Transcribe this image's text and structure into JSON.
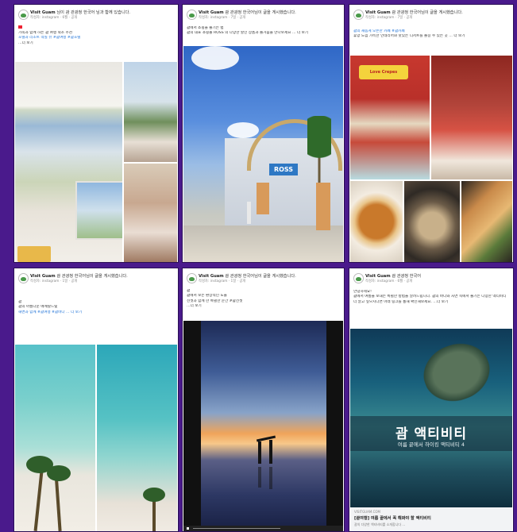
{
  "page": {
    "background": "#4a1a8c"
  },
  "posts": [
    {
      "author": "Visit Guam",
      "author_suffix": "님이 괌 관광청 한국어 님과 함께 있습니다.",
      "meta": "작성자: instagram · 6월 · 공개",
      "lines": [
        "가족과 함께 하는 괌 여행 숙소 추천",
        "호텔과 리조트 객실 뷰 #괌여행 #괌호텔",
        "…더 보기"
      ],
      "photos": [
        "hotel-lobby",
        "ocean-view-room",
        "room-interior"
      ]
    },
    {
      "author": "Visit Guam",
      "author_suffix": "괌 관광청 한국어님이 글을 게시했습니다.",
      "meta": "작성자: instagram · 7일 · 공개",
      "lines": [
        "괌에서 쇼핑을 즐기는 법",
        "괌의 대표 쇼핑몰 ROSS 의 다양한 할인 상품과 즐거움을 만나보세요 … 더 보기"
      ],
      "photos": [
        "ross-store"
      ],
      "store_sign": "ROSS"
    },
    {
      "author": "Visit Guam",
      "author_suffix": "괌 관광청 한국어님이 글을 게시했습니다.",
      "meta": "작성자: instagram · 7일 · 공개",
      "lines": [
        "괌의 새롭게 오픈한 카페 #괌카페",
        "휴양 느낌 가득한 인테리어와 맛있는 디저트를 즐길 수 있는 곳 … 더 보기"
      ],
      "photos": [
        "cafe-exterior",
        "cafe-interior",
        "food-pizza",
        "food-bowl",
        "food-crepe"
      ],
      "cafe_sign": "Love Crepes"
    },
    {
      "author": "Visit Guam",
      "author_suffix": "괌 관광청 한국어님이 글을 게시했습니다.",
      "meta": "작성자: instagram · 1일 · 공개",
      "lines": [
        "괌",
        "괌의 아름다운 에메랄드빛",
        "해변과 함께 #괌여행 #괌바다 … 더 보기"
      ],
      "photos": [
        "beach-palms-left",
        "beach-aerial-right"
      ]
    },
    {
      "author": "Visit Guam",
      "author_suffix": "괌 관광청 한국어님이 글을 게시했습니다.",
      "meta": "작성자: instagram · 1일 · 공개",
      "lines": [
        "괌",
        "괌에서 보는 환상적인 노을",
        "선셋과 함께 한 특별한 순간 #괌선셋",
        "…더 보기"
      ],
      "photos": [
        "sunset-video"
      ],
      "video": {
        "state": "paused"
      }
    },
    {
      "author": "Visit Guam",
      "author_suffix": "괌 관광청 한국어",
      "meta": "작성자: instagram · 6월 · 공개",
      "lines": [
        "안녕하세요!",
        "괌에서 여름을 보내는 특별한 방법을 알려드립니다. 괌의 바다와 자연 속에서 즐기는 다양한 액티비티",
        "더 알고 싶으시다면 아래 링크를 통해 확인해보세요. …더 보기"
      ],
      "photos": [
        "sea-turtle"
      ],
      "overlay_title": "괌 액티비티",
      "overlay_subtitle": "여름 끝에서 하이킹 액티비티 4",
      "link": {
        "source": "VISITGUAM.COM",
        "title": "[괌여행] 여름 끝에서 꼭 해봐야 할 액티비티",
        "desc": "괌의 다양한 액티비티를 소개합니다 …"
      }
    }
  ]
}
